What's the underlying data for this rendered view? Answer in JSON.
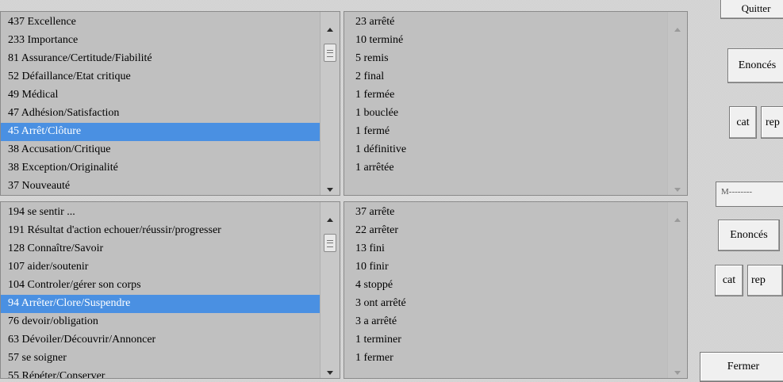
{
  "top_left_list": {
    "items": [
      "437 Excellence",
      "233 Importance",
      " 81 Assurance/Certitude/Fiabilité",
      " 52 Défaillance/Etat critique",
      " 49 Médical",
      " 47 Adhésion/Satisfaction",
      " 45 Arrêt/Clôture",
      " 38 Accusation/Critique",
      " 38 Exception/Originalité",
      " 37 Nouveauté"
    ],
    "selected_index": 6
  },
  "top_right_list": {
    "items": [
      "23 arrêté",
      "10 terminé",
      " 5 remis",
      " 2 final",
      " 1 fermée",
      " 1 bouclée",
      " 1 fermé",
      " 1 définitive",
      " 1 arrêtée"
    ]
  },
  "bottom_left_list": {
    "items": [
      "194 se sentir ...",
      "191 Résultat d'action echouer/réussir/progresser",
      "128 Connaître/Savoir",
      "107 aider/soutenir",
      "104 Controler/gérer son corps",
      " 94 Arrêter/Clore/Suspendre",
      " 76 devoir/obligation",
      " 63 Dévoiler/Découvrir/Annoncer",
      " 57 se soigner",
      " 55 Répéter/Conserver"
    ],
    "selected_index": 5
  },
  "bottom_right_list": {
    "items": [
      "37 arrête",
      "22 arrêter",
      "13 fini",
      "10 finir",
      " 4 stoppé",
      " 3 ont arrêté",
      " 3 a arrêté",
      " 1 terminer",
      " 1 fermer"
    ]
  },
  "side": {
    "top_button_label": "Quitter",
    "enonces_top_label": "Enoncés",
    "cat_top_label": "cat",
    "rep_top_label": "rep",
    "field_text": "M--------",
    "enonces_bottom_label": "Enoncés",
    "cat_bottom_label": "cat",
    "rep_bottom_label": "rep",
    "fermer_label": "Fermer"
  },
  "colors": {
    "selection": "#4a90e2",
    "panel_bg": "#c0c0c0"
  }
}
